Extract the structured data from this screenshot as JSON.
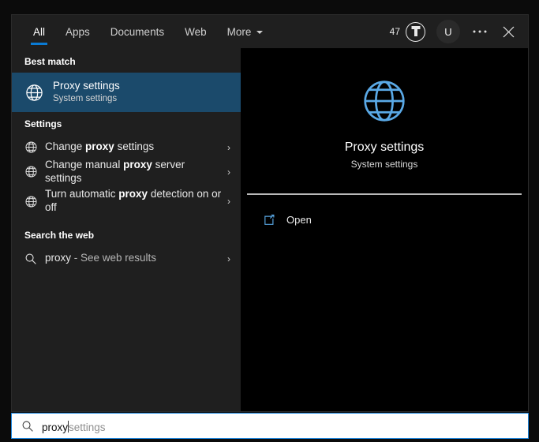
{
  "header": {
    "tabs": [
      {
        "label": "All",
        "active": true
      },
      {
        "label": "Apps",
        "active": false
      },
      {
        "label": "Documents",
        "active": false
      },
      {
        "label": "Web",
        "active": false
      },
      {
        "label": "More",
        "active": false,
        "has_caret": true
      }
    ],
    "rewards_count": "47",
    "rewards_icon": "rewards-trophy-icon",
    "avatar_initial": "U",
    "more_options_icon": "ellipsis-icon",
    "close_icon": "close-icon",
    "accent_color": "#0a7bd4"
  },
  "results": {
    "best_match_label": "Best match",
    "best_match": {
      "icon": "globe-icon",
      "title": "Proxy settings",
      "subtitle": "System settings",
      "highlight_color": "#1b4a6b"
    },
    "settings_label": "Settings",
    "settings_items": [
      {
        "icon": "globe-icon",
        "pre": "Change ",
        "bold": "proxy",
        "post": " settings",
        "chevron": "›"
      },
      {
        "icon": "globe-icon",
        "pre": "Change manual ",
        "bold": "proxy",
        "post": " server settings",
        "chevron": "›"
      },
      {
        "icon": "globe-icon",
        "pre": "Turn automatic ",
        "bold": "proxy",
        "post": " detection on or off",
        "chevron": "›"
      }
    ],
    "web_label": "Search the web",
    "web_items": [
      {
        "icon": "search-icon",
        "pre": "proxy",
        "post": " - See web results",
        "chevron": "›"
      }
    ]
  },
  "preview": {
    "icon": "globe-icon",
    "icon_color": "#5aa9e6",
    "title": "Proxy settings",
    "subtitle": "System settings",
    "actions": [
      {
        "icon": "open-external-icon",
        "label": "Open"
      }
    ]
  },
  "search": {
    "icon": "search-icon",
    "typed_text": "proxy",
    "suggestion_text": " settings",
    "border_color": "#1f88e0"
  }
}
